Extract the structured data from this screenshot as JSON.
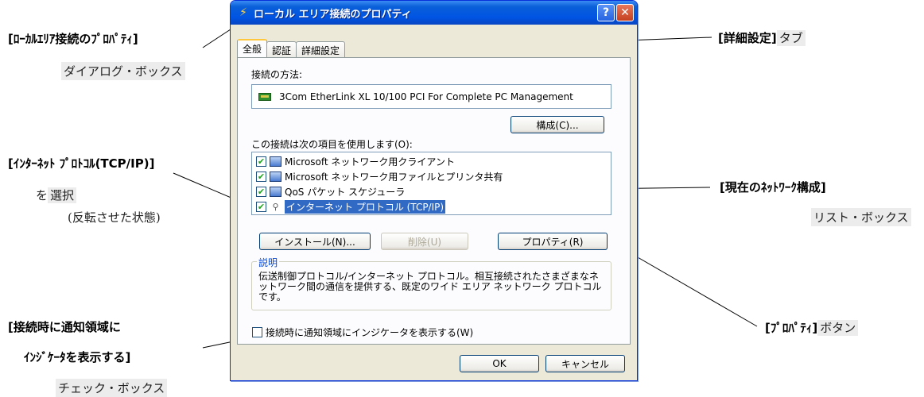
{
  "dialog": {
    "title": "ローカル エリア接続のプロパティ",
    "help_button": "?",
    "close_button": "✕",
    "tabs": [
      {
        "label": "全般"
      },
      {
        "label": "認証"
      },
      {
        "label": "詳細設定"
      }
    ],
    "connect_using_label": "接続の方法:",
    "adapter_name": "3Com EtherLink XL 10/100 PCI For Complete PC Management",
    "configure_button": "構成(C)...",
    "items_label": "この接続は次の項目を使用します(O):",
    "items": [
      {
        "label": "Microsoft ネットワーク用クライアント",
        "checked": true,
        "icon": "network-client-icon"
      },
      {
        "label": "Microsoft ネットワーク用ファイルとプリンタ共有",
        "checked": true,
        "icon": "file-printer-sharing-icon"
      },
      {
        "label": "QoS パケット スケジューラ",
        "checked": true,
        "icon": "qos-scheduler-icon"
      },
      {
        "label": "インターネット プロトコル (TCP/IP)",
        "checked": true,
        "icon": "protocol-icon",
        "selected": true
      }
    ],
    "install_button": "インストール(N)...",
    "uninstall_button": "削除(U)",
    "properties_button": "プロパティ(R)",
    "description_title": "説明",
    "description_text": "伝送制御プロトコル/インターネット プロトコル。相互接続されたさまざまなネットワーク間の通信を提供する、既定のワイド エリア ネットワーク プロトコルです。",
    "notify_checkbox_label": "接続時に通知領域にインジケータを表示する(W)",
    "notify_checked": false,
    "ok_button": "OK",
    "cancel_button": "キャンセル"
  },
  "annotations": {
    "dialog_title": "[ﾛｰｶﾙｴﾘｱ接続のﾌﾟﾛﾊﾟﾃｨ]",
    "dialog_sub": "ダイアログ・ボックス",
    "protocol_title": "[ｲﾝﾀｰﾈｯﾄ ﾌﾟﾛﾄｺﾙ(TCP/IP)]",
    "protocol_select_prefix": "を",
    "protocol_select_word": "選択",
    "protocol_note": "(反転させた状態)",
    "notify_title_line1": "[接続時に通知領域に",
    "notify_title_line2": "ｲﾝｼﾞｹｰﾀを表示する]",
    "notify_sub": "チェック・ボックス",
    "advanced_tab_title": "[詳細設定]",
    "advanced_tab_sub": "タブ",
    "network_config_title": "[現在のﾈｯﾄﾜｰｸ構成]",
    "network_config_sub": "リスト・ボックス",
    "properties_title": "[ﾌﾟﾛﾊﾟﾃｨ]",
    "properties_sub": "ボタン"
  }
}
